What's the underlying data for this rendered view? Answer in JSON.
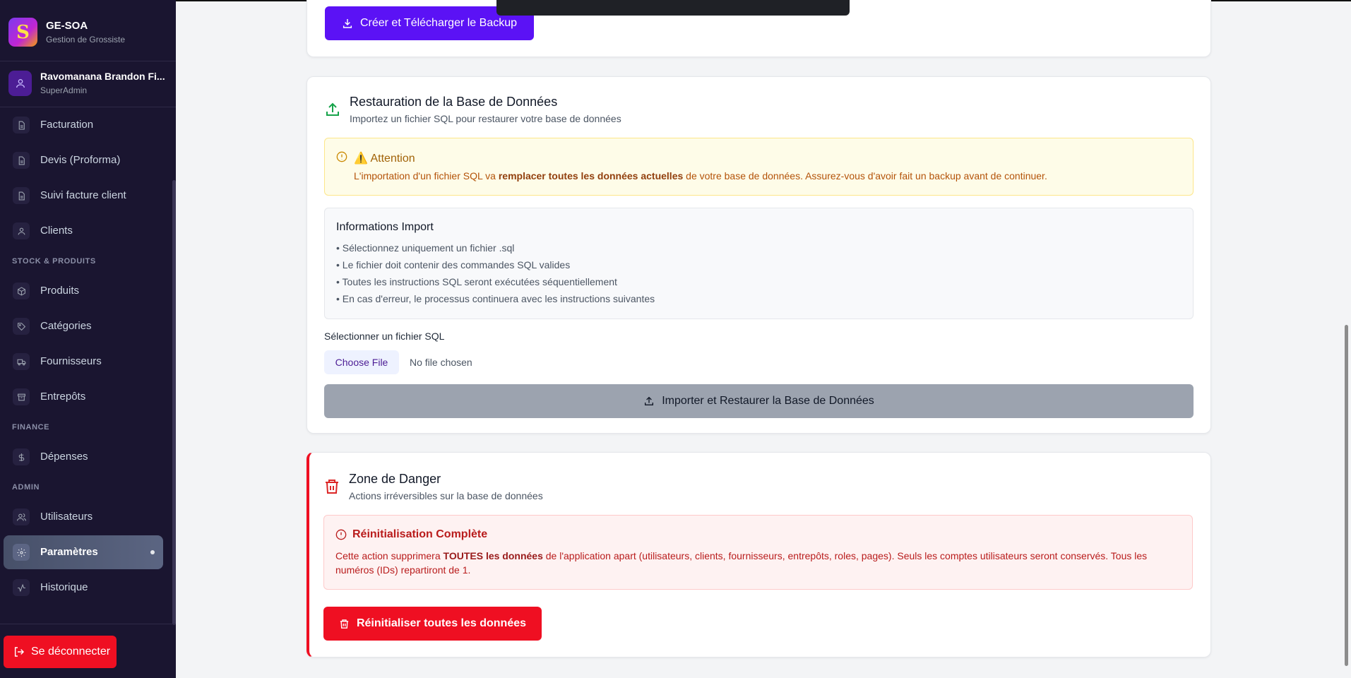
{
  "brand": {
    "name": "GE-SOA",
    "subtitle": "Gestion de Grossiste",
    "logo_letter": "S"
  },
  "user": {
    "name": "Ravomanana Brandon Fi...",
    "role": "SuperAdmin"
  },
  "nav": {
    "items_top": [
      {
        "label": "Facturation",
        "icon": "file-icon"
      },
      {
        "label": "Devis (Proforma)",
        "icon": "file-icon"
      },
      {
        "label": "Suivi facture client",
        "icon": "file-icon"
      },
      {
        "label": "Clients",
        "icon": "user-icon"
      }
    ],
    "section_stock": "STOCK & PRODUITS",
    "items_stock": [
      {
        "label": "Produits",
        "icon": "box-icon"
      },
      {
        "label": "Catégories",
        "icon": "tag-icon"
      },
      {
        "label": "Fournisseurs",
        "icon": "truck-icon"
      },
      {
        "label": "Entrepôts",
        "icon": "archive-icon"
      }
    ],
    "section_finance": "FINANCE",
    "items_finance": [
      {
        "label": "Dépenses",
        "icon": "dollar-icon"
      }
    ],
    "section_admin": "ADMIN",
    "items_admin": [
      {
        "label": "Utilisateurs",
        "icon": "users-icon"
      },
      {
        "label": "Paramètres",
        "icon": "gear-icon",
        "active": true
      },
      {
        "label": "Historique",
        "icon": "activity-icon"
      }
    ],
    "logout": "Se déconnecter"
  },
  "backup": {
    "button": "Créer et Télécharger le Backup"
  },
  "restore": {
    "title": "Restauration de la Base de Données",
    "subtitle": "Importez un fichier SQL pour restaurer votre base de données",
    "alert_title": "⚠️ Attention",
    "alert_pre": "L'importation d'un fichier SQL va ",
    "alert_bold": "remplacer toutes les données actuelles",
    "alert_post": " de votre base de données. Assurez-vous d'avoir fait un backup avant de continuer.",
    "info_title": "Informations Import",
    "info_items": [
      "• Sélectionnez uniquement un fichier .sql",
      "• Le fichier doit contenir des commandes SQL valides",
      "• Toutes les instructions SQL seront exécutées séquentiellement",
      "• En cas d'erreur, le processus continuera avec les instructions suivantes"
    ],
    "file_label": "Sélectionner un fichier SQL",
    "file_button": "Choose File",
    "file_status": "No file chosen",
    "import_button": "Importer et Restaurer la Base de Données"
  },
  "danger": {
    "title": "Zone de Danger",
    "subtitle": "Actions irréversibles sur la base de données",
    "alert_title": "Réinitialisation Complète",
    "alert_pre": "Cette action supprimera ",
    "alert_bold": "TOUTES les données",
    "alert_post": " de l'application apart (utilisateurs, clients, fournisseurs, entrepôts, roles, pages). Seuls les comptes utilisateurs seront conservés. Tous les numéros (IDs) repartiront de 1.",
    "button": "Réinitialiser toutes les données"
  },
  "colors": {
    "primary": "#5b12f5",
    "danger": "#ef0f22",
    "sidebar": "#1a1530",
    "success": "#16a34a",
    "warning": "#a16207"
  }
}
